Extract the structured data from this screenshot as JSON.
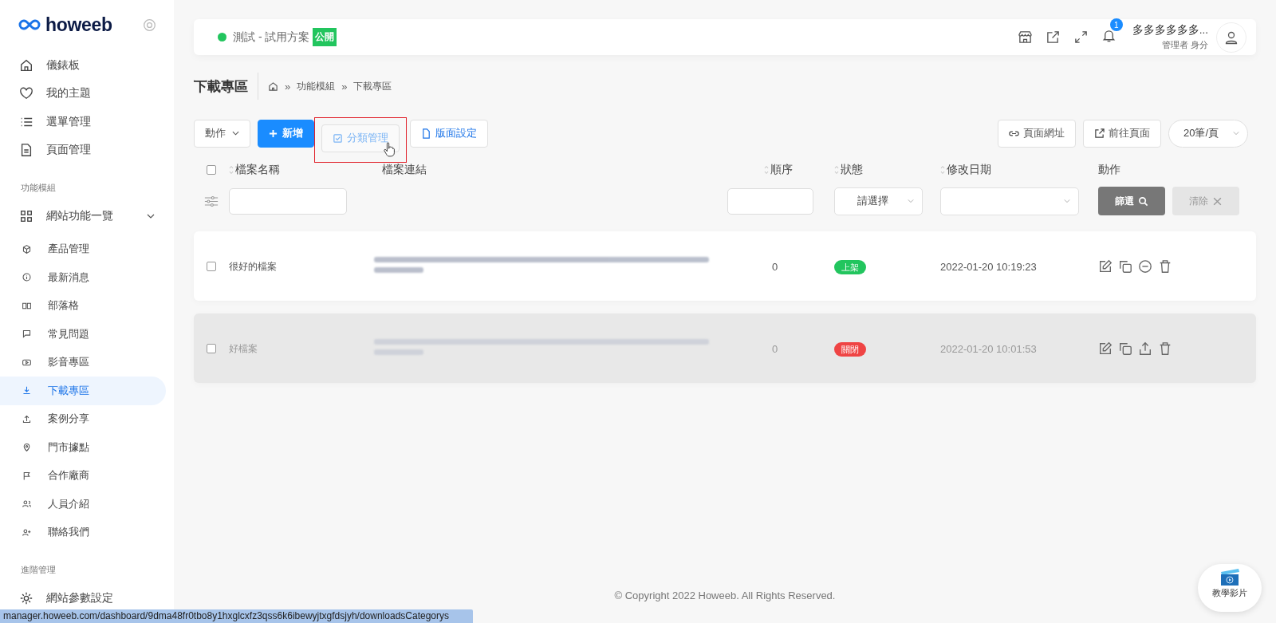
{
  "sidebar": {
    "logo": "howeeb",
    "groups": [
      {
        "items": [
          {
            "label": "儀錶板",
            "selected": false
          },
          {
            "label": "我的主題",
            "selected": false
          },
          {
            "label": "選單管理",
            "selected": false
          },
          {
            "label": "頁面管理",
            "selected": false
          }
        ]
      },
      {
        "heading": "功能模組",
        "items": [
          {
            "label": "網站功能一覽",
            "selected": false,
            "expanded": true,
            "children": [
              {
                "label": "產品管理",
                "selected": false
              },
              {
                "label": "最新消息",
                "selected": false
              },
              {
                "label": "部落格",
                "selected": false
              },
              {
                "label": "常見問題",
                "selected": false
              },
              {
                "label": "影音專區",
                "selected": false
              },
              {
                "label": "下載專區",
                "selected": true
              },
              {
                "label": "案例分享",
                "selected": false
              },
              {
                "label": "門市據點",
                "selected": false
              },
              {
                "label": "合作廠商",
                "selected": false
              },
              {
                "label": "人員介紹",
                "selected": false
              },
              {
                "label": "聯絡我們",
                "selected": false
              }
            ]
          }
        ]
      },
      {
        "heading": "進階管理",
        "items": [
          {
            "label": "網站參數設定",
            "selected": false
          }
        ]
      }
    ]
  },
  "topbar": {
    "site": {
      "online": true,
      "name": "測試 - 試用方案",
      "badge": "公開"
    },
    "notifications": "1",
    "user": {
      "name": "多多多多多多...",
      "role": "管理者 身分"
    }
  },
  "page": {
    "title": "下載專區",
    "breadcrumb": [
      {
        "sep": "»",
        "label": "功能模組"
      },
      {
        "sep": "»",
        "label": "下載專區"
      }
    ]
  },
  "toolbar": {
    "action": "動作",
    "add": "新增",
    "categories": {
      "label": "分類管理",
      "highlighted": true
    },
    "layout": "版面設定",
    "page_url": "頁面網址",
    "go_page": "前往頁面",
    "page_size": "20筆/頁"
  },
  "table": {
    "columns": [
      {
        "label": "檔案名稱",
        "sortable": true
      },
      {
        "label": "檔案連結",
        "sortable": false
      },
      {
        "label": "順序",
        "sortable": true
      },
      {
        "label": "狀態",
        "sortable": true
      },
      {
        "label": "修改日期",
        "sortable": true
      },
      {
        "label": "動作",
        "sortable": false
      }
    ],
    "all_checked": false,
    "filters": {
      "status_placeholder": "請選擇",
      "filter_button": "篩選",
      "clear_button": "清除"
    },
    "rows": [
      {
        "checked": false,
        "enabled": true,
        "name": "很好的檔案",
        "order": "0",
        "status": "上架",
        "color": "#22c55e",
        "date": "2022-01-20 10:19:23"
      },
      {
        "checked": false,
        "enabled": false,
        "name": "好檔案",
        "order": "0",
        "status": "關閉",
        "color": "#ef4444",
        "date": "2022-01-20 10:01:53"
      }
    ]
  },
  "footer": "© Copyright 2022 Howeeb. All Rights Reserved.",
  "help": "教學影片",
  "status_bar": "manager.howeeb.com/dashboard/9dma48fr0tbo8y1hxglcxfz3qss6k6ibewyjtxgfdsjyh/downloadsCategorys"
}
